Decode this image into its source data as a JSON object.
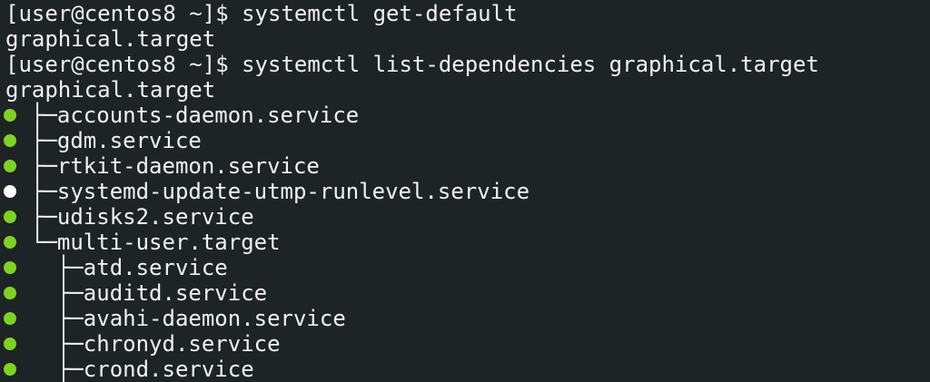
{
  "terminal": {
    "colors": {
      "background": "#1e2326",
      "text": "#f1f1f1",
      "active": "#7ed321",
      "inactive": "#ffffff"
    },
    "lines": [
      {
        "type": "prompt",
        "prompt": "[user@centos8 ~]$ ",
        "command": "systemctl get-default"
      },
      {
        "type": "output",
        "text": "graphical.target"
      },
      {
        "type": "prompt",
        "prompt": "[user@centos8 ~]$ ",
        "command": "systemctl list-dependencies graphical.target"
      },
      {
        "type": "output",
        "text": "graphical.target"
      }
    ],
    "tree": [
      {
        "status": "active",
        "text": "├─accounts-daemon.service"
      },
      {
        "status": "active",
        "text": "├─gdm.service"
      },
      {
        "status": "active",
        "text": "├─rtkit-daemon.service"
      },
      {
        "status": "inactive",
        "text": "├─systemd-update-utmp-runlevel.service"
      },
      {
        "status": "active",
        "text": "├─udisks2.service"
      },
      {
        "status": "active",
        "text": "└─multi-user.target"
      },
      {
        "status": "active",
        "text": "  ├─atd.service"
      },
      {
        "status": "active",
        "text": "  ├─auditd.service"
      },
      {
        "status": "active",
        "text": "  ├─avahi-daemon.service"
      },
      {
        "status": "active",
        "text": "  ├─chronyd.service"
      },
      {
        "status": "active",
        "text": "  ├─crond.service"
      }
    ]
  }
}
